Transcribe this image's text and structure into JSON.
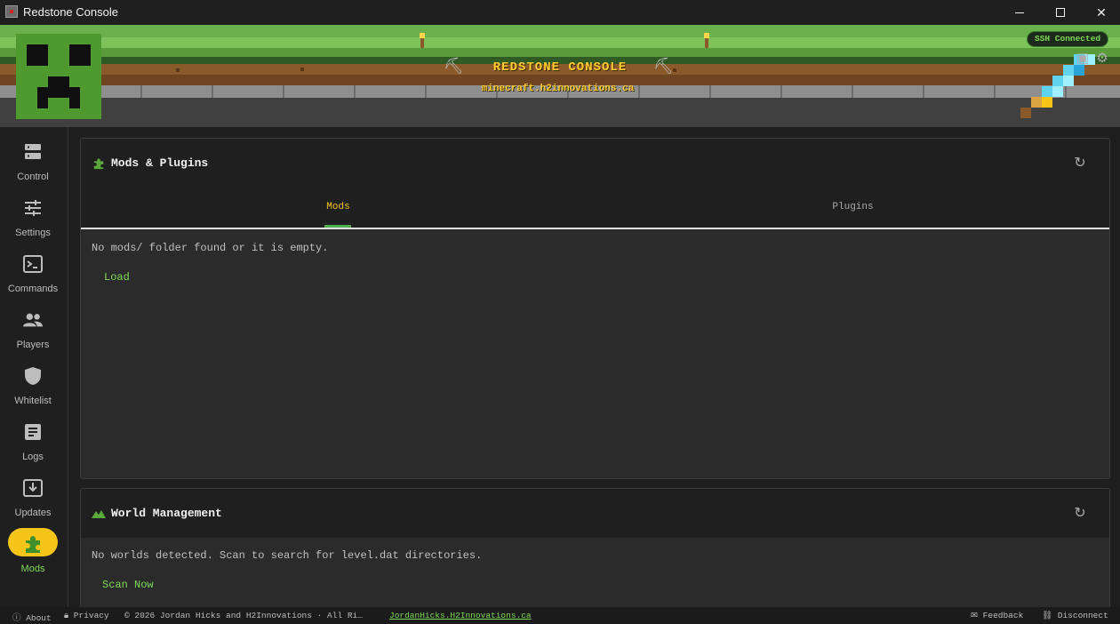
{
  "window": {
    "title": "Redstone Console"
  },
  "header": {
    "title": "REDSTONE CONSOLE",
    "host": "minecraft.h2innovations.ca",
    "ssh_status": "SSH Connected"
  },
  "sidebar": {
    "items": [
      {
        "label": "Control",
        "icon": "server-icon",
        "active": false
      },
      {
        "label": "Settings",
        "icon": "sliders-icon",
        "active": false
      },
      {
        "label": "Commands",
        "icon": "terminal-icon",
        "active": false
      },
      {
        "label": "Players",
        "icon": "users-icon",
        "active": false
      },
      {
        "label": "Whitelist",
        "icon": "shield-icon",
        "active": false
      },
      {
        "label": "Logs",
        "icon": "document-icon",
        "active": false
      },
      {
        "label": "Updates",
        "icon": "download-icon",
        "active": false
      },
      {
        "label": "Mods",
        "icon": "puzzle-icon",
        "active": true
      }
    ]
  },
  "mods_card": {
    "title": "Mods & Plugins",
    "tabs": [
      {
        "label": "Mods",
        "active": true
      },
      {
        "label": "Plugins",
        "active": false
      }
    ],
    "empty_message": "No mods/ folder found or it is empty.",
    "load_label": "Load"
  },
  "world_card": {
    "title": "World Management",
    "empty_message": "No worlds detected. Scan to search for level.dat directories.",
    "scan_label": "Scan Now"
  },
  "footer": {
    "about": "About",
    "privacy": "Privacy",
    "copyright": "© 2026 Jordan Hicks and H2Innovations · All Ri…",
    "site_link": "JordanHicks.H2Innovations.ca",
    "feedback": "Feedback",
    "disconnect": "Disconnect"
  },
  "colors": {
    "accent_yellow": "#f5c518",
    "accent_green": "#7ed957",
    "panel": "#2b2b2b",
    "sidebar": "#1f1f1f"
  }
}
